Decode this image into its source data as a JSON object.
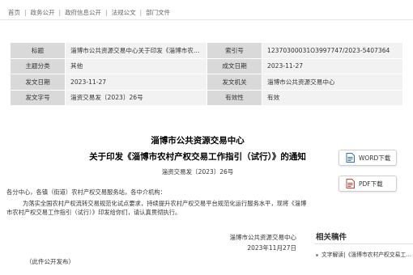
{
  "breadcrumb": [
    "首页",
    "政务公开",
    "政府信息公开",
    "法规公文",
    "部门文件"
  ],
  "meta": {
    "rows": [
      [
        {
          "label": "标题",
          "value": "淄博市公共资源交易中心关于印发《淄博市农村产权交易工作指引（试行）》的通知"
        },
        {
          "label": "索引号",
          "value": "12370300031O3997747/2023-5407364"
        }
      ],
      [
        {
          "label": "主题分类",
          "value": "其他"
        },
        {
          "label": "成文日期",
          "value": "2023-11-27"
        }
      ],
      [
        {
          "label": "发文日期",
          "value": "2023-11-27"
        },
        {
          "label": "发文机关",
          "value": "淄博市公共资源交易中心"
        }
      ],
      [
        {
          "label": "发文字号",
          "value": "淄资交易发〔2023〕26号"
        },
        {
          "label": "有效性",
          "value": "有效"
        }
      ]
    ]
  },
  "document": {
    "title_line1": "淄博市公共资源交易中心",
    "title_line2": "关于印发《淄博市农村产权交易工作指引（试行）》的通知",
    "doc_number": "淄资交易发〔2023〕26号",
    "greeting": "各分中心，各镇（街道）农村产权交易服务站，各中介机构：",
    "paragraph": "为落实全国农村产权流转交易规范化试点要求，持续提升农村产权交易平台规范化运行服务水平，现将《淄博市农村产权交易工作指引（试行）》印发给你们，请认真贯彻执行。",
    "signature_org": "淄博市公共资源交易中心",
    "signature_date": "2023年11月27日",
    "publish_note": "（此件公开发布）"
  },
  "downloads": {
    "word_label": "WORD下载",
    "pdf_label": "PDF下载"
  },
  "related": {
    "heading": "相关稿件",
    "items": [
      "文字解读|《淄博市农村产权交易工作指引（试行）》"
    ]
  },
  "colors": {
    "label_bg": "#d9d9d9",
    "value_bg": "#f2f2f2",
    "word_icon": "#2b6fc2",
    "pdf_icon": "#d83b2f"
  }
}
